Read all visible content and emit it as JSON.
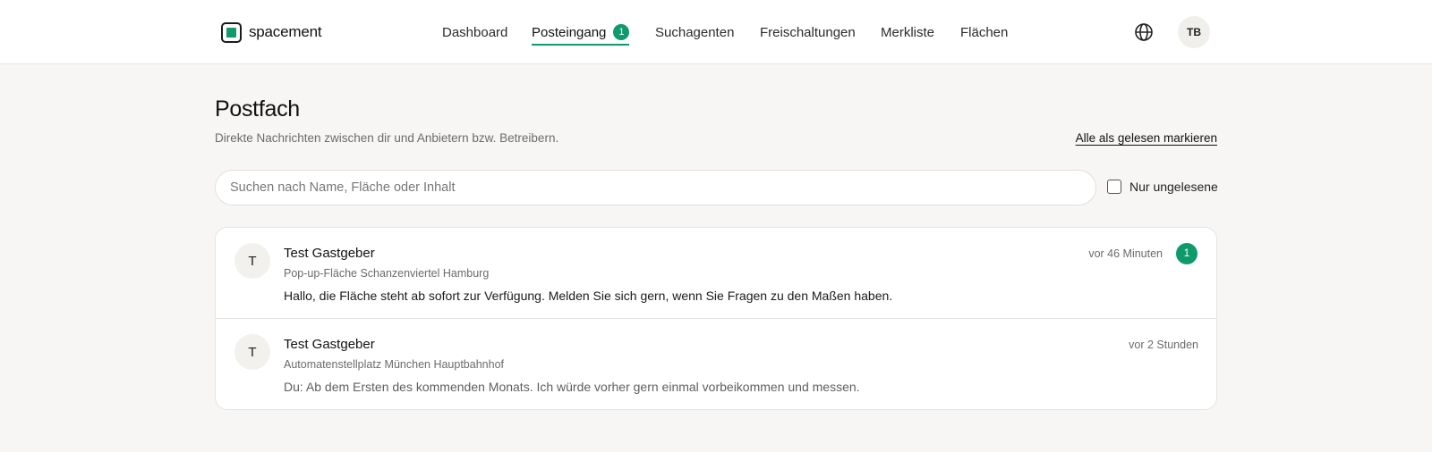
{
  "brand": {
    "name": "spacement",
    "accent": "#0f9a6c",
    "logo_icon": "square-logo-icon"
  },
  "nav": {
    "items": [
      {
        "label": "Dashboard"
      },
      {
        "label": "Posteingang",
        "badge": "1",
        "active": true
      },
      {
        "label": "Suchagenten"
      },
      {
        "label": "Freischaltungen"
      },
      {
        "label": "Merkliste"
      },
      {
        "label": "Flächen"
      }
    ]
  },
  "header": {
    "language_icon": "globe-icon",
    "avatar_initials": "TB"
  },
  "page": {
    "title": "Postfach",
    "subtitle": "Direkte Nachrichten zwischen dir und Anbietern bzw. Betreibern.",
    "mark_all_read": "Alle als gelesen markieren"
  },
  "search": {
    "placeholder": "Suchen nach Name, Fläche oder Inhalt",
    "value": ""
  },
  "filter": {
    "unread_only_label": "Nur ungelesene",
    "checked": false
  },
  "conversations": [
    {
      "initial": "T",
      "name": "Test Gastgeber",
      "location": "Pop-up-Fläche Schanzenviertel Hamburg",
      "message": "Hallo, die Fläche steht ab sofort zur Verfügung. Melden Sie sich gern, wenn Sie Fragen zu den Maßen haben.",
      "time": "vor 46 Minuten",
      "unread_count": "1"
    },
    {
      "initial": "T",
      "name": "Test Gastgeber",
      "location": "Automatenstellplatz München Hauptbahnhof",
      "message": "Du: Ab dem Ersten des kommenden Monats. Ich würde vorher gern einmal vorbeikommen und messen.",
      "time": "vor 2 Stunden"
    }
  ]
}
